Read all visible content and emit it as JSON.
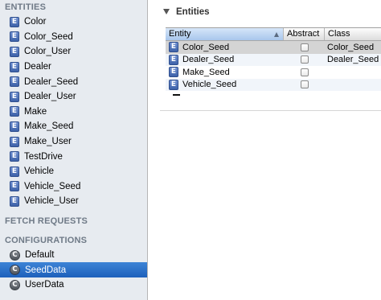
{
  "sidebar": {
    "entities_header": "ENTITIES",
    "entities": [
      {
        "label": "Color",
        "icon": "entity-icon",
        "icon_letter": "E"
      },
      {
        "label": "Color_Seed",
        "icon": "entity-icon",
        "icon_letter": "E"
      },
      {
        "label": "Color_User",
        "icon": "entity-icon",
        "icon_letter": "E"
      },
      {
        "label": "Dealer",
        "icon": "entity-icon",
        "icon_letter": "E"
      },
      {
        "label": "Dealer_Seed",
        "icon": "entity-icon",
        "icon_letter": "E"
      },
      {
        "label": "Dealer_User",
        "icon": "entity-icon",
        "icon_letter": "E"
      },
      {
        "label": "Make",
        "icon": "entity-icon",
        "icon_letter": "E"
      },
      {
        "label": "Make_Seed",
        "icon": "entity-icon",
        "icon_letter": "E"
      },
      {
        "label": "Make_User",
        "icon": "entity-icon",
        "icon_letter": "E"
      },
      {
        "label": "TestDrive",
        "icon": "entity-icon",
        "icon_letter": "E"
      },
      {
        "label": "Vehicle",
        "icon": "entity-icon",
        "icon_letter": "E"
      },
      {
        "label": "Vehicle_Seed",
        "icon": "entity-icon",
        "icon_letter": "E"
      },
      {
        "label": "Vehicle_User",
        "icon": "entity-icon",
        "icon_letter": "E"
      }
    ],
    "fetch_requests_header": "FETCH REQUESTS",
    "configurations_header": "CONFIGURATIONS",
    "configurations": [
      {
        "label": "Default",
        "icon": "configuration-icon",
        "icon_letter": "C",
        "selected": false
      },
      {
        "label": "SeedData",
        "icon": "configuration-icon",
        "icon_letter": "C",
        "selected": true
      },
      {
        "label": "UserData",
        "icon": "configuration-icon",
        "icon_letter": "C",
        "selected": false
      }
    ]
  },
  "main": {
    "panel_title": "Entities",
    "table": {
      "columns": [
        "Entity",
        "Abstract",
        "Class"
      ],
      "sorted_column": "Entity",
      "rows": [
        {
          "entity": "Color_Seed",
          "abstract": false,
          "class": "Color_Seed",
          "selected": true
        },
        {
          "entity": "Dealer_Seed",
          "abstract": false,
          "class": "Dealer_Seed",
          "selected": false
        },
        {
          "entity": "Make_Seed",
          "abstract": false,
          "class": "",
          "selected": false
        },
        {
          "entity": "Vehicle_Seed",
          "abstract": false,
          "class": "",
          "selected": false
        }
      ]
    },
    "remove_button_icon": "minus-icon"
  },
  "colors": {
    "sidebar_bg": "#e7ebf0",
    "selection_blue": "#2a6fc9",
    "header_gray": "#6f7a87",
    "entity_icon": "#4a6fb5"
  }
}
